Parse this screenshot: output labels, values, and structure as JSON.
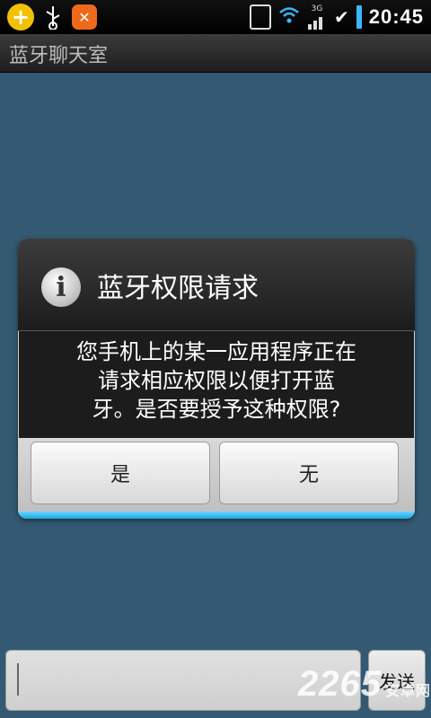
{
  "status_bar": {
    "time": "20:45",
    "left_icons": [
      "plus-app-icon",
      "usb-icon",
      "tools-app-icon"
    ],
    "right_icons": [
      "vibrate-icon",
      "wifi-icon",
      "signal-3g-icon",
      "signal-icon",
      "check-icon",
      "battery-icon"
    ],
    "network_label": "3G"
  },
  "app": {
    "title": "蓝牙聊天室"
  },
  "dialog": {
    "title": "蓝牙权限请求",
    "message_lines": [
      "您手机上的某一应用程序正在",
      "请求相应权限以便打开蓝",
      "牙。是否要授予这种权限?"
    ],
    "buttons": {
      "yes": "是",
      "no": "无"
    }
  },
  "input_bar": {
    "message_value": "",
    "send_label": "发送"
  },
  "watermark": {
    "text": "2265",
    "suffix": "安卓网"
  },
  "colors": {
    "background": "#335a72",
    "accent": "#1aa6e0"
  }
}
